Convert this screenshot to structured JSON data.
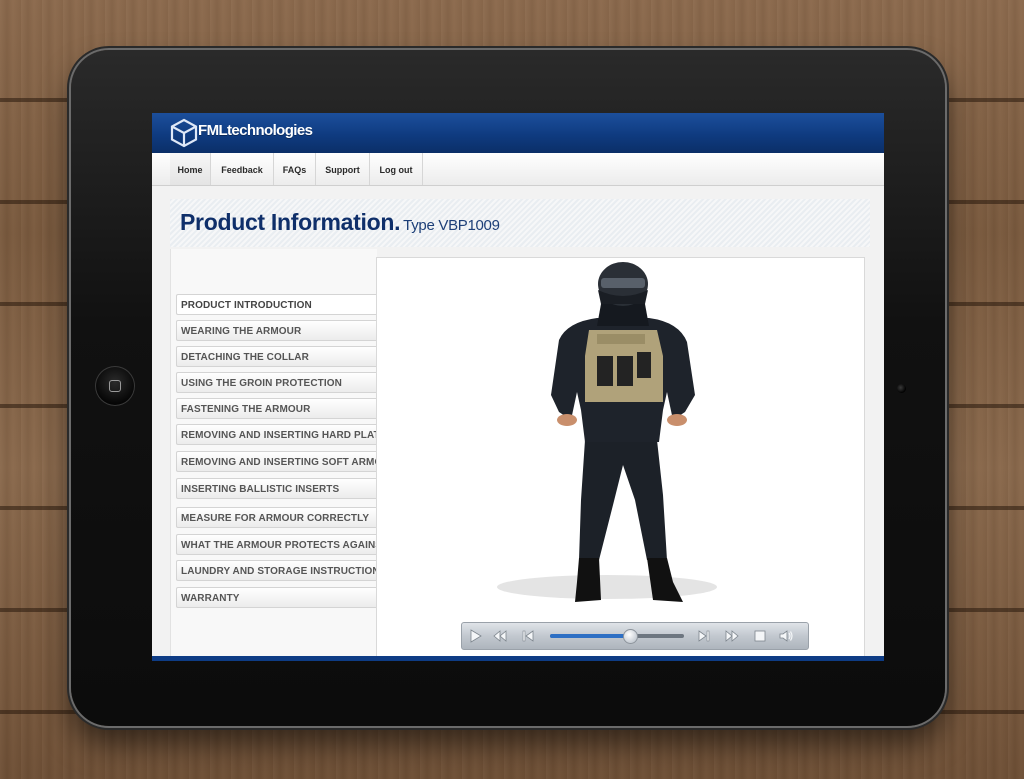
{
  "brand": {
    "name": "FMLtechnologies"
  },
  "nav": {
    "items": [
      {
        "label": "Home",
        "active": true
      },
      {
        "label": "Feedback"
      },
      {
        "label": "FAQs"
      },
      {
        "label": "Support"
      },
      {
        "label": "Log out"
      }
    ]
  },
  "page": {
    "title": "Product Information.",
    "subtitle": "Type VBP1009"
  },
  "sidebar": {
    "items": [
      {
        "label": "PRODUCT INTRODUCTION",
        "active": true
      },
      {
        "label": "WEARING THE ARMOUR"
      },
      {
        "label": "DETACHING THE COLLAR"
      },
      {
        "label": "USING THE GROIN PROTECTION"
      },
      {
        "label": "FASTENING THE ARMOUR"
      },
      {
        "label": "REMOVING AND INSERTING HARD PLATES"
      },
      {
        "label": "REMOVING AND INSERTING SOFT ARMOUR"
      },
      {
        "label": "INSERTING BALLISTIC INSERTS"
      },
      {
        "label": "MEASURE FOR ARMOUR CORRECTLY"
      },
      {
        "label": "WHAT THE ARMOUR PROTECTS AGAINST"
      },
      {
        "label": "LAUNDRY AND STORAGE INSTRUCTIONS"
      },
      {
        "label": "WARRANTY"
      }
    ]
  },
  "player": {
    "progress": 0.6,
    "controls": [
      "play-icon",
      "rewind-icon",
      "skip-back-icon",
      "skip-forward-icon",
      "fast-forward-icon",
      "stop-icon",
      "volume-icon"
    ]
  },
  "colors": {
    "brand_blue": "#0f3b80",
    "title_blue": "#0f2f6a",
    "player_progress": "#2d6fc4"
  }
}
